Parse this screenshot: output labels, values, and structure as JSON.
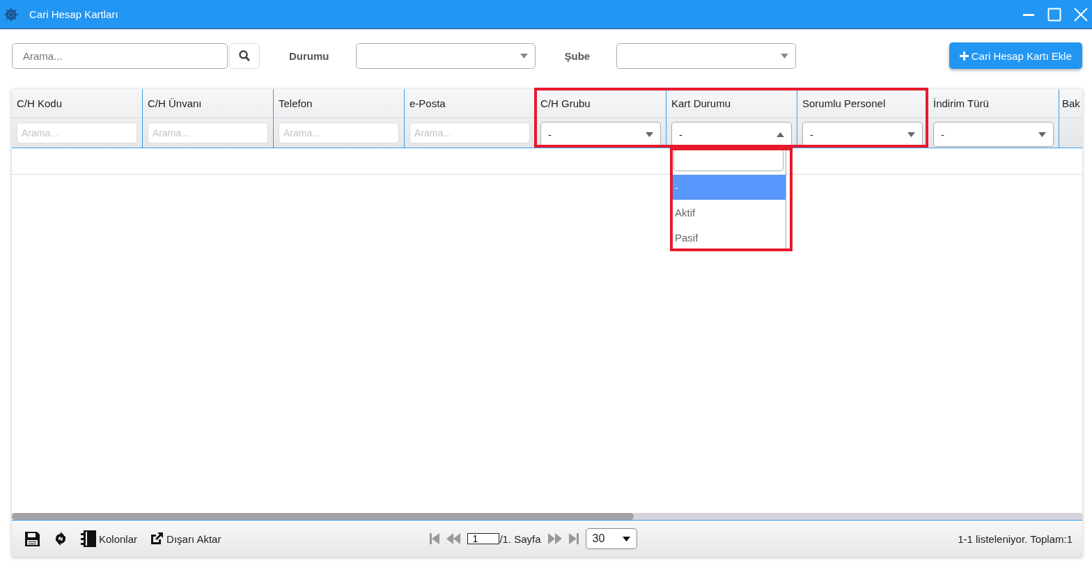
{
  "window": {
    "title": "Cari Hesap Kartları"
  },
  "toolbar": {
    "search": {
      "placeholder": "Arama..."
    },
    "filters": [
      {
        "label": "Durumu"
      },
      {
        "label": "Şube"
      }
    ],
    "add_button": "Cari Hesap Kartı Ekle"
  },
  "grid": {
    "columns": [
      {
        "header": "C/H Kodu",
        "filter": {
          "kind": "text",
          "placeholder": "Arama..."
        }
      },
      {
        "header": "C/H Ünvanı",
        "filter": {
          "kind": "text",
          "placeholder": "Arama..."
        }
      },
      {
        "header": "Telefon",
        "filter": {
          "kind": "text",
          "placeholder": "Arama..."
        }
      },
      {
        "header": "e-Posta",
        "filter": {
          "kind": "text",
          "placeholder": "Arama..."
        }
      },
      {
        "header": "C/H Grubu",
        "filter": {
          "kind": "select",
          "value": "-",
          "expanded": false
        }
      },
      {
        "header": "Kart Durumu",
        "filter": {
          "kind": "select",
          "value": "-",
          "expanded": true
        }
      },
      {
        "header": "Sorumlu Personel",
        "filter": {
          "kind": "select",
          "value": "-",
          "expanded": false
        }
      },
      {
        "header": "İndirim Türü",
        "filter": {
          "kind": "select",
          "value": "-",
          "expanded": false
        }
      },
      {
        "header": "Bak"
      }
    ],
    "dropdown": {
      "options": [
        {
          "label": "-",
          "selected": true
        },
        {
          "label": "Aktif",
          "selected": false
        },
        {
          "label": "Pasif",
          "selected": false
        }
      ]
    }
  },
  "footer": {
    "tools": [
      {
        "kind": "save"
      },
      {
        "kind": "refresh"
      },
      {
        "kind": "columns",
        "label": "Kolonlar"
      },
      {
        "kind": "export",
        "label": "Dışarı Aktar"
      }
    ],
    "page": "1",
    "page_label": "/1. Sayfa",
    "page_size": "30",
    "summary": "1-1 listeleniyor. Toplam:1"
  }
}
